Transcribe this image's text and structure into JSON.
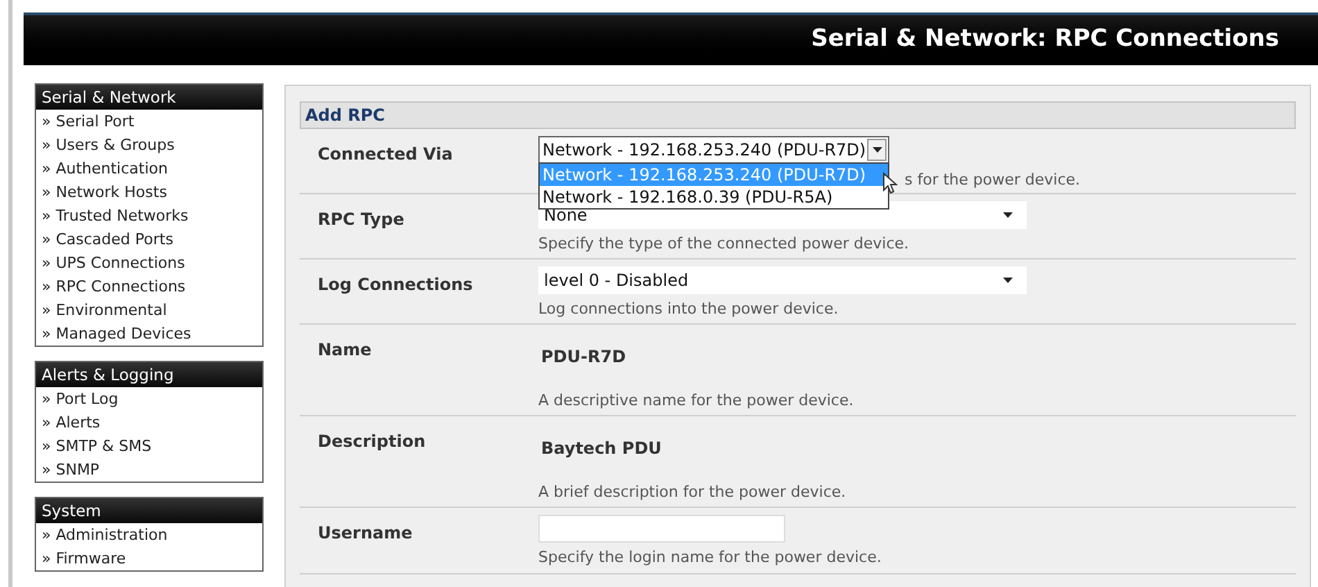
{
  "header": {
    "title": "Serial & Network: RPC Connections"
  },
  "sidebar": {
    "sections": [
      {
        "title": "Serial & Network",
        "items": [
          {
            "marker": "»",
            "label": "Serial Port"
          },
          {
            "marker": "»",
            "label": "Users & Groups"
          },
          {
            "marker": "»",
            "label": "Authentication"
          },
          {
            "marker": "»",
            "label": "Network Hosts"
          },
          {
            "marker": "»",
            "label": "Trusted Networks"
          },
          {
            "marker": "»",
            "label": "Cascaded Ports"
          },
          {
            "marker": "»",
            "label": "UPS Connections"
          },
          {
            "marker": "»",
            "label": "RPC Connections"
          },
          {
            "marker": "»",
            "label": "Environmental"
          },
          {
            "marker": "»",
            "label": "Managed Devices"
          }
        ]
      },
      {
        "title": "Alerts & Logging",
        "items": [
          {
            "marker": "»",
            "label": "Port Log"
          },
          {
            "marker": "»",
            "label": "Alerts"
          },
          {
            "marker": "»",
            "label": "SMTP & SMS"
          },
          {
            "marker": "»",
            "label": "SNMP"
          }
        ]
      },
      {
        "title": "System",
        "items": [
          {
            "marker": "»",
            "label": "Administration"
          },
          {
            "marker": "»",
            "label": "Firmware"
          }
        ]
      }
    ]
  },
  "form": {
    "title": "Add RPC",
    "fields": [
      {
        "kind": "select",
        "label": "Connected Via",
        "value": "Network - 192.168.253.240 (PDU-R7D)",
        "help": "s for the power device.",
        "expanded": true,
        "options": [
          {
            "label": "Network - 192.168.253.240 (PDU-R7D)",
            "selected": true
          },
          {
            "label": "Network - 192.168.0.39 (PDU-R5A)",
            "selected": false
          }
        ]
      },
      {
        "kind": "select",
        "label": "RPC Type",
        "value": "None",
        "help": "Specify the type of the connected power device.",
        "expanded": false
      },
      {
        "kind": "select",
        "label": "Log Connections",
        "value": "level 0 - Disabled",
        "help": "Log connections into the power device.",
        "expanded": false
      },
      {
        "kind": "static",
        "label": "Name",
        "value": "PDU-R7D",
        "help": "A descriptive name for the power device."
      },
      {
        "kind": "static",
        "label": "Description",
        "value": "Baytech PDU",
        "help": "A brief description for the power device."
      },
      {
        "kind": "input",
        "label": "Username",
        "help": "Specify the login name for the power device."
      }
    ]
  }
}
